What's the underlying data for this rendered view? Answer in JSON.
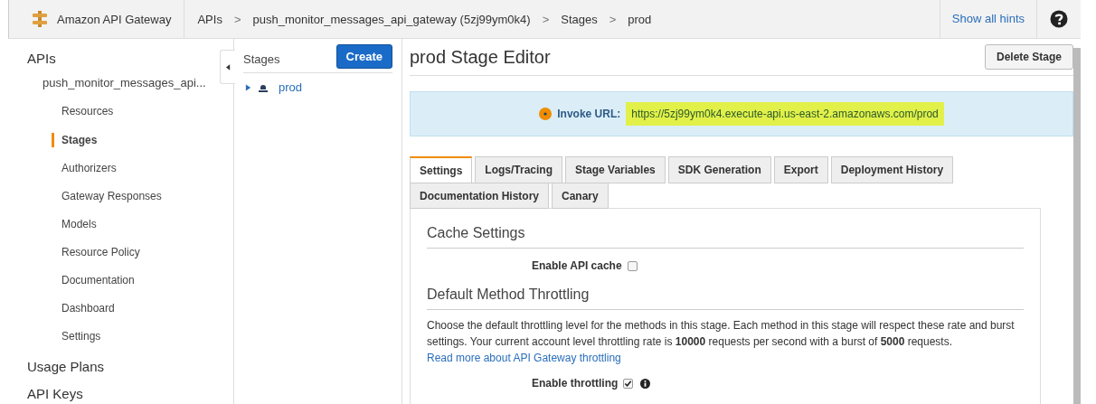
{
  "top_bar": {
    "service": "Amazon API Gateway",
    "breadcrumbs": [
      {
        "kind": "link",
        "label": "APIs"
      },
      {
        "kind": "separator",
        "label": ">"
      },
      {
        "kind": "link",
        "label": "push_monitor_messages_api_gateway (5zj99ym0k4)"
      },
      {
        "kind": "separator",
        "label": ">"
      },
      {
        "kind": "link",
        "label": "Stages"
      },
      {
        "kind": "separator",
        "label": ">"
      },
      {
        "kind": "link",
        "label": "prod"
      }
    ],
    "hints_link": "Show all hints"
  },
  "sidebar": {
    "sections": [
      {
        "label": "APIs",
        "api": "push_monitor_messages_api...",
        "items": [
          {
            "label": "Resources",
            "selected": false
          },
          {
            "label": "Stages",
            "selected": true
          },
          {
            "label": "Authorizers",
            "selected": false
          },
          {
            "label": "Gateway Responses",
            "selected": false
          },
          {
            "label": "Models",
            "selected": false
          },
          {
            "label": "Resource Policy",
            "selected": false
          },
          {
            "label": "Documentation",
            "selected": false
          },
          {
            "label": "Dashboard",
            "selected": false
          },
          {
            "label": "Settings",
            "selected": false
          }
        ]
      },
      {
        "label": "Usage Plans"
      },
      {
        "label": "API Keys"
      }
    ]
  },
  "stages_panel": {
    "title": "Stages",
    "create_button": "Create",
    "stages": [
      {
        "label": "prod",
        "expanded": false
      }
    ]
  },
  "editor": {
    "title": "prod Stage Editor",
    "delete_button": "Delete Stage",
    "invoke_label": "Invoke URL:",
    "invoke_url": "https://5zj99ym0k4.execute-api.us-east-2.amazonaws.com/prod",
    "tabs": [
      {
        "label": "Settings",
        "selected": true
      },
      {
        "label": "Logs/Tracing",
        "selected": false
      },
      {
        "label": "Stage Variables",
        "selected": false
      },
      {
        "label": "SDK Generation",
        "selected": false
      },
      {
        "label": "Export",
        "selected": false
      },
      {
        "label": "Deployment History",
        "selected": false
      },
      {
        "label": "Documentation History",
        "selected": false
      },
      {
        "label": "Canary",
        "selected": false
      }
    ],
    "cache_heading": "Cache Settings",
    "cache_label": "Enable API cache",
    "cache_checked": false,
    "throttle_heading": "Default Method Throttling",
    "throttle_text": "Choose the default throttling level for the methods in this stage. Each method in this stage will respect these rate and burst settings. Your current account level throttling rate is **10000** requests per second with a burst of **5000** requests.",
    "throttle_link": "Read more about API Gateway throttling",
    "throttle_label": "Enable throttling",
    "throttle_checked": true
  }
}
